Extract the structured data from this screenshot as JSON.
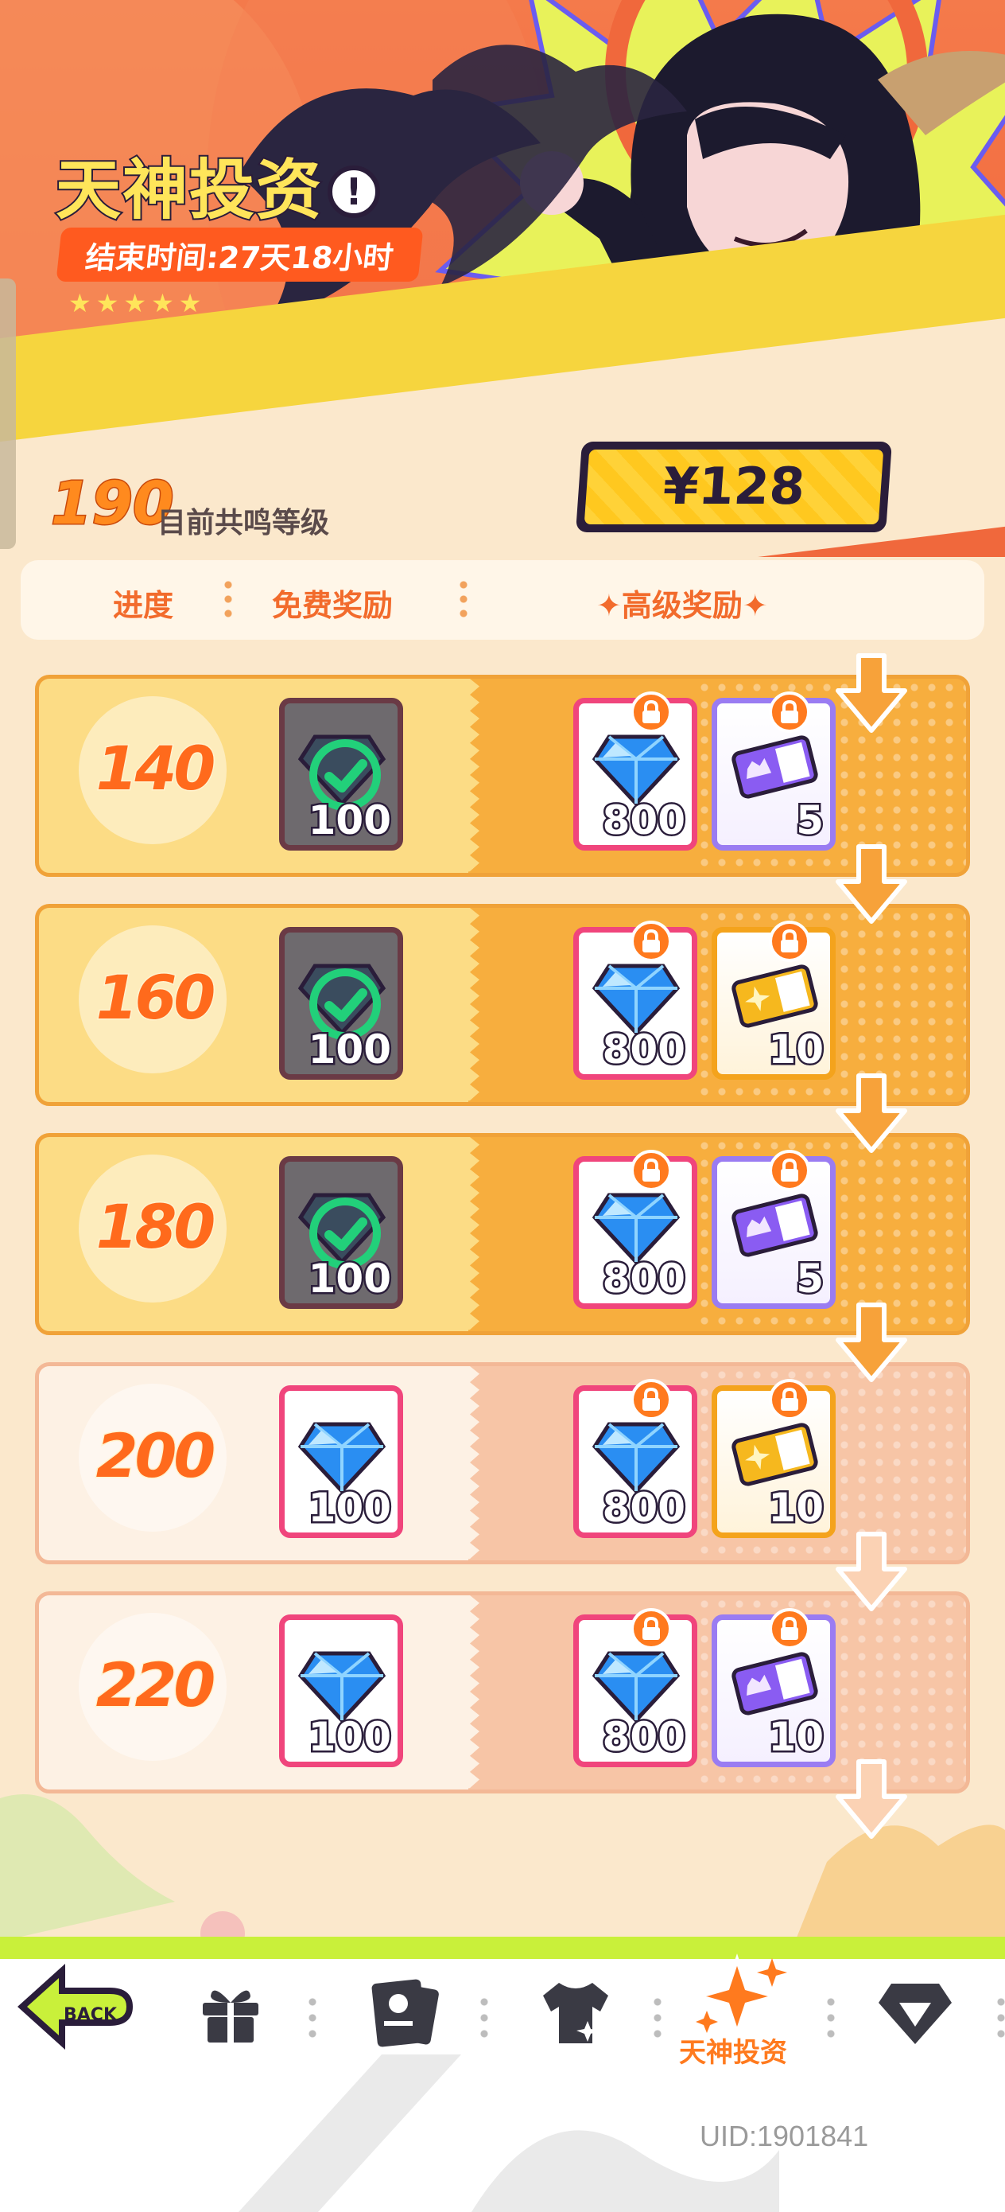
{
  "banner": {
    "title_main": "天神",
    "title_sub": "投资",
    "info_icon": "exclamation-icon",
    "end_time": "结束时间:27天18小时",
    "stars": "★★★★★",
    "price": "¥128",
    "current_level": "190",
    "current_level_label": "目前共鸣等级"
  },
  "header": {
    "progress": "进度",
    "free": "免费奖励",
    "premium": "✦高级奖励✦"
  },
  "rows": [
    {
      "level": "140",
      "free_qty": "100",
      "premium": [
        {
          "qty": "800",
          "item": "diamond"
        },
        {
          "qty": "5",
          "item": "purple-ticket"
        }
      ]
    },
    {
      "level": "160",
      "free_qty": "100",
      "premium": [
        {
          "qty": "800",
          "item": "diamond"
        },
        {
          "qty": "10",
          "item": "gold-ticket"
        }
      ]
    },
    {
      "level": "180",
      "free_qty": "100",
      "premium": [
        {
          "qty": "800",
          "item": "diamond"
        },
        {
          "qty": "5",
          "item": "purple-ticket"
        }
      ]
    },
    {
      "level": "200",
      "free_qty": "100",
      "premium": [
        {
          "qty": "800",
          "item": "diamond"
        },
        {
          "qty": "10",
          "item": "gold-ticket"
        }
      ]
    },
    {
      "level": "220",
      "free_qty": "100",
      "premium": [
        {
          "qty": "800",
          "item": "diamond"
        },
        {
          "qty": "10",
          "item": "purple-ticket"
        }
      ]
    }
  ],
  "nav": {
    "back_label": "BACK",
    "active_label": "天神投资",
    "uid": "UID:1901841"
  },
  "colors": {
    "accent": "#ff7a1e",
    "banner": "#f26b3f",
    "lime": "#c9f03a"
  }
}
